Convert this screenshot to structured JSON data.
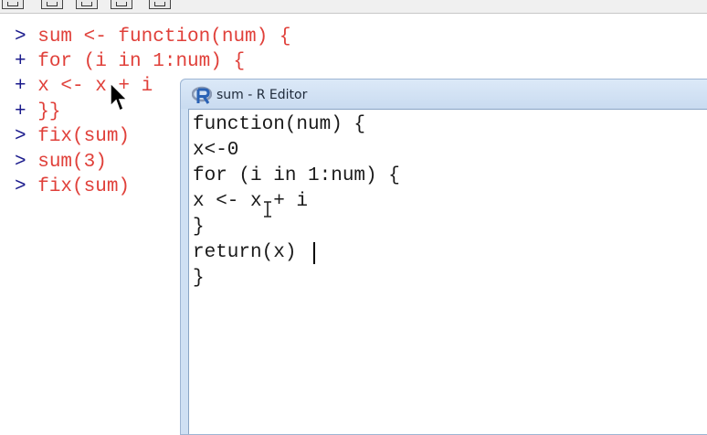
{
  "toolbar": {
    "icons": [
      "open-script-icon",
      "save-icon",
      "copy-paste-icon",
      "print-icon",
      "stop-icon"
    ]
  },
  "console": {
    "lines": [
      {
        "prompt": ">",
        "code": "sum <- function(num) {"
      },
      {
        "prompt": "+",
        "code": "for (i in 1:num) {"
      },
      {
        "prompt": "+",
        "code": "x <- x + i"
      },
      {
        "prompt": "+",
        "code": "}}"
      },
      {
        "prompt": ">",
        "code": "fix(sum)"
      },
      {
        "prompt": ">",
        "code": "sum(3)"
      },
      {
        "prompt": ">",
        "code": "fix(sum)"
      }
    ]
  },
  "editor": {
    "title": "sum - R Editor",
    "icon": "r-logo-icon",
    "code_lines": [
      "function(num) {",
      "x<-0",
      "for (i in 1:num) {",
      "x <- x + i",
      "}",
      "return(x)",
      "}"
    ]
  },
  "colors": {
    "console_code": "#e0403a",
    "console_prompt": "#1a1a8c",
    "editor_title_bg": "#cfe0f3"
  }
}
